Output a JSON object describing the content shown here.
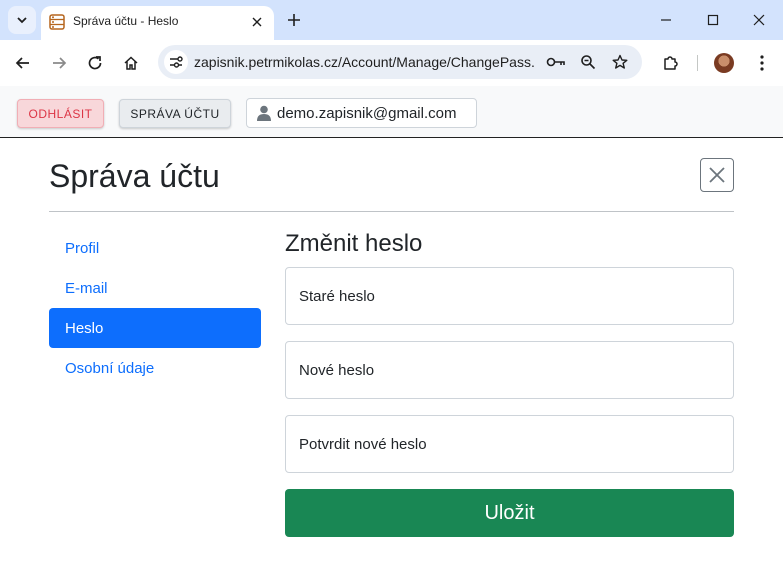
{
  "browser": {
    "tab_title": "Správa účtu - Heslo",
    "url": "zapisnik.petrmikolas.cz/Account/Manage/ChangePass..."
  },
  "app_bar": {
    "logout_label": "ODHLÁSIT",
    "account_label": "SPRÁVA ÚČTU",
    "user_email": "demo.zapisnik@gmail.com"
  },
  "modal": {
    "title": "Správa účtu"
  },
  "sidebar": {
    "items": [
      {
        "label": "Profil",
        "active": false
      },
      {
        "label": "E-mail",
        "active": false
      },
      {
        "label": "Heslo",
        "active": true
      },
      {
        "label": "Osobní údaje",
        "active": false
      }
    ]
  },
  "form": {
    "title": "Změnit heslo",
    "old_password_label": "Staré heslo",
    "new_password_label": "Nové heslo",
    "confirm_password_label": "Potvrdit nové heslo",
    "save_label": "Uložit"
  },
  "colors": {
    "primary": "#0d6efd",
    "success": "#198754",
    "danger": "#dc3545",
    "tabstrip": "#d3e3fd"
  }
}
